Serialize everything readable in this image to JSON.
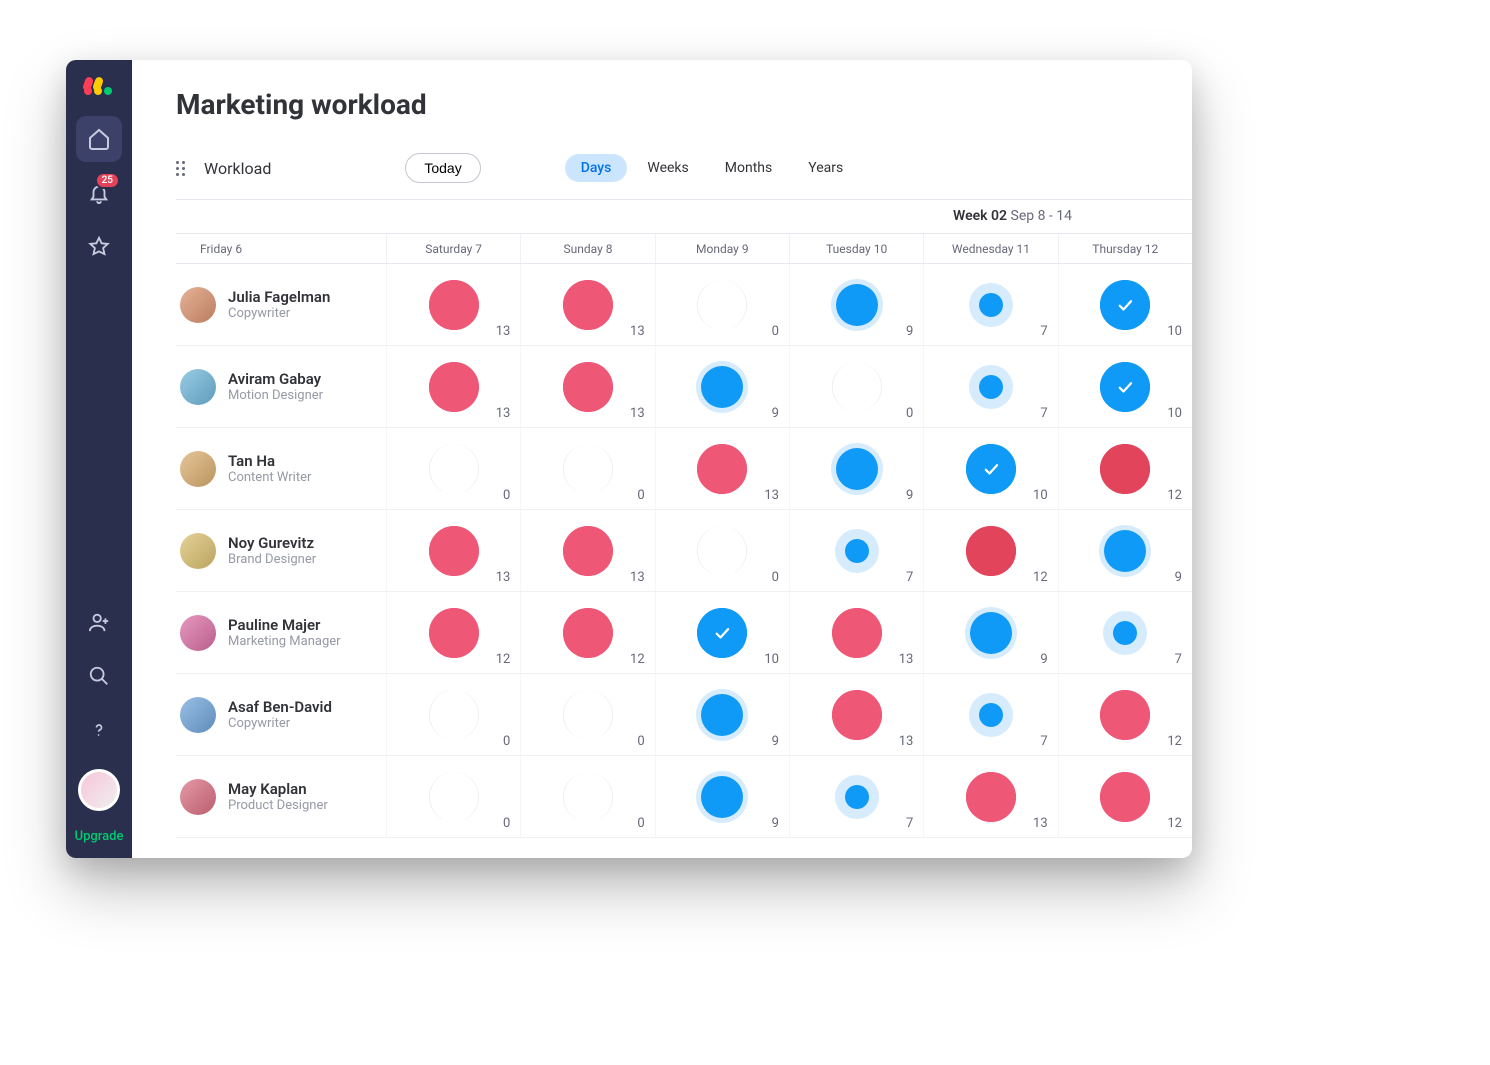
{
  "colors": {
    "pink": "#ef5777",
    "red": "#e2445c",
    "blue": "#0f9af7",
    "blue_light": "#d6ecfc",
    "gray": "#f1f2f5",
    "gray_border": "#eceef3"
  },
  "rail": {
    "notification_count": "25",
    "upgrade_label": "Upgrade"
  },
  "header": {
    "title": "Marketing workload"
  },
  "toolbar": {
    "view_name": "Workload",
    "today_label": "Today",
    "range_tabs": [
      "Days",
      "Weeks",
      "Months",
      "Years"
    ],
    "range_active_index": 0
  },
  "week": {
    "bold": "Week 02",
    "rest": "Sep 8 - 14"
  },
  "day_headers": [
    "Friday 6",
    "Saturday 7",
    "Sunday 8",
    "Monday 9",
    "Tuesday 10",
    "Wednesday 11",
    "Thursday 12"
  ],
  "people": [
    {
      "name": "Julia Fagelman",
      "role": "Copywriter",
      "avatar_hue": 20
    },
    {
      "name": "Aviram Gabay",
      "role": "Motion Designer",
      "avatar_hue": 200
    },
    {
      "name": "Tan Ha",
      "role": "Content Writer",
      "avatar_hue": 35
    },
    {
      "name": "Noy Gurevitz",
      "role": "Brand Designer",
      "avatar_hue": 45
    },
    {
      "name": "Pauline Majer",
      "role": "Marketing Manager",
      "avatar_hue": 330
    },
    {
      "name": "Asaf Ben-David",
      "role": "Copywriter",
      "avatar_hue": 210
    },
    {
      "name": "May Kaplan",
      "role": "Product Designer",
      "avatar_hue": 350
    }
  ],
  "cells": [
    [
      {
        "v": 13,
        "t": "pink"
      },
      {
        "v": 13,
        "t": "pink"
      },
      {
        "v": 0,
        "t": "empty"
      },
      {
        "v": 9,
        "t": "blue"
      },
      {
        "v": 7,
        "t": "blue_sm"
      },
      {
        "v": 10,
        "t": "blue_check"
      }
    ],
    [
      {
        "v": 13,
        "t": "pink"
      },
      {
        "v": 13,
        "t": "pink"
      },
      {
        "v": 9,
        "t": "blue"
      },
      {
        "v": 0,
        "t": "empty"
      },
      {
        "v": 7,
        "t": "blue_sm"
      },
      {
        "v": 10,
        "t": "blue_check"
      }
    ],
    [
      {
        "v": 0,
        "t": "empty"
      },
      {
        "v": 0,
        "t": "empty"
      },
      {
        "v": 13,
        "t": "pink"
      },
      {
        "v": 9,
        "t": "blue"
      },
      {
        "v": 10,
        "t": "blue_check"
      },
      {
        "v": 12,
        "t": "red"
      }
    ],
    [
      {
        "v": 13,
        "t": "pink"
      },
      {
        "v": 13,
        "t": "pink"
      },
      {
        "v": 0,
        "t": "empty"
      },
      {
        "v": 7,
        "t": "blue_sm"
      },
      {
        "v": 12,
        "t": "red"
      },
      {
        "v": 9,
        "t": "blue"
      }
    ],
    [
      {
        "v": 12,
        "t": "pink"
      },
      {
        "v": 12,
        "t": "pink"
      },
      {
        "v": 10,
        "t": "blue_check"
      },
      {
        "v": 13,
        "t": "pink"
      },
      {
        "v": 9,
        "t": "blue"
      },
      {
        "v": 7,
        "t": "blue_sm"
      }
    ],
    [
      {
        "v": 0,
        "t": "empty"
      },
      {
        "v": 0,
        "t": "empty"
      },
      {
        "v": 9,
        "t": "blue"
      },
      {
        "v": 13,
        "t": "pink"
      },
      {
        "v": 7,
        "t": "blue_sm"
      },
      {
        "v": 12,
        "t": "pink"
      }
    ],
    [
      {
        "v": 0,
        "t": "empty"
      },
      {
        "v": 0,
        "t": "empty"
      },
      {
        "v": 9,
        "t": "blue"
      },
      {
        "v": 7,
        "t": "blue_sm"
      },
      {
        "v": 13,
        "t": "pink"
      },
      {
        "v": 12,
        "t": "pink"
      }
    ]
  ],
  "bubble_styles": {
    "pink": {
      "outer": 50,
      "inner": 50,
      "outer_bg": "#ef5777",
      "inner_bg": "#ef5777",
      "check": false
    },
    "red": {
      "outer": 50,
      "inner": 50,
      "outer_bg": "#e2445c",
      "inner_bg": "#e2445c",
      "check": false
    },
    "blue": {
      "outer": 52,
      "inner": 42,
      "outer_bg": "#d6ecfc",
      "inner_bg": "#0f9af7",
      "check": false
    },
    "blue_sm": {
      "outer": 44,
      "inner": 24,
      "outer_bg": "#d6ecfc",
      "inner_bg": "#0f9af7",
      "check": false
    },
    "blue_check": {
      "outer": 50,
      "inner": 50,
      "outer_bg": "#0f9af7",
      "inner_bg": "#0f9af7",
      "check": true
    },
    "empty": {
      "outer": 50,
      "inner": 50,
      "outer_bg": "#ffffff",
      "inner_bg": "#ffffff",
      "check": false,
      "border": "#eceef3"
    }
  }
}
